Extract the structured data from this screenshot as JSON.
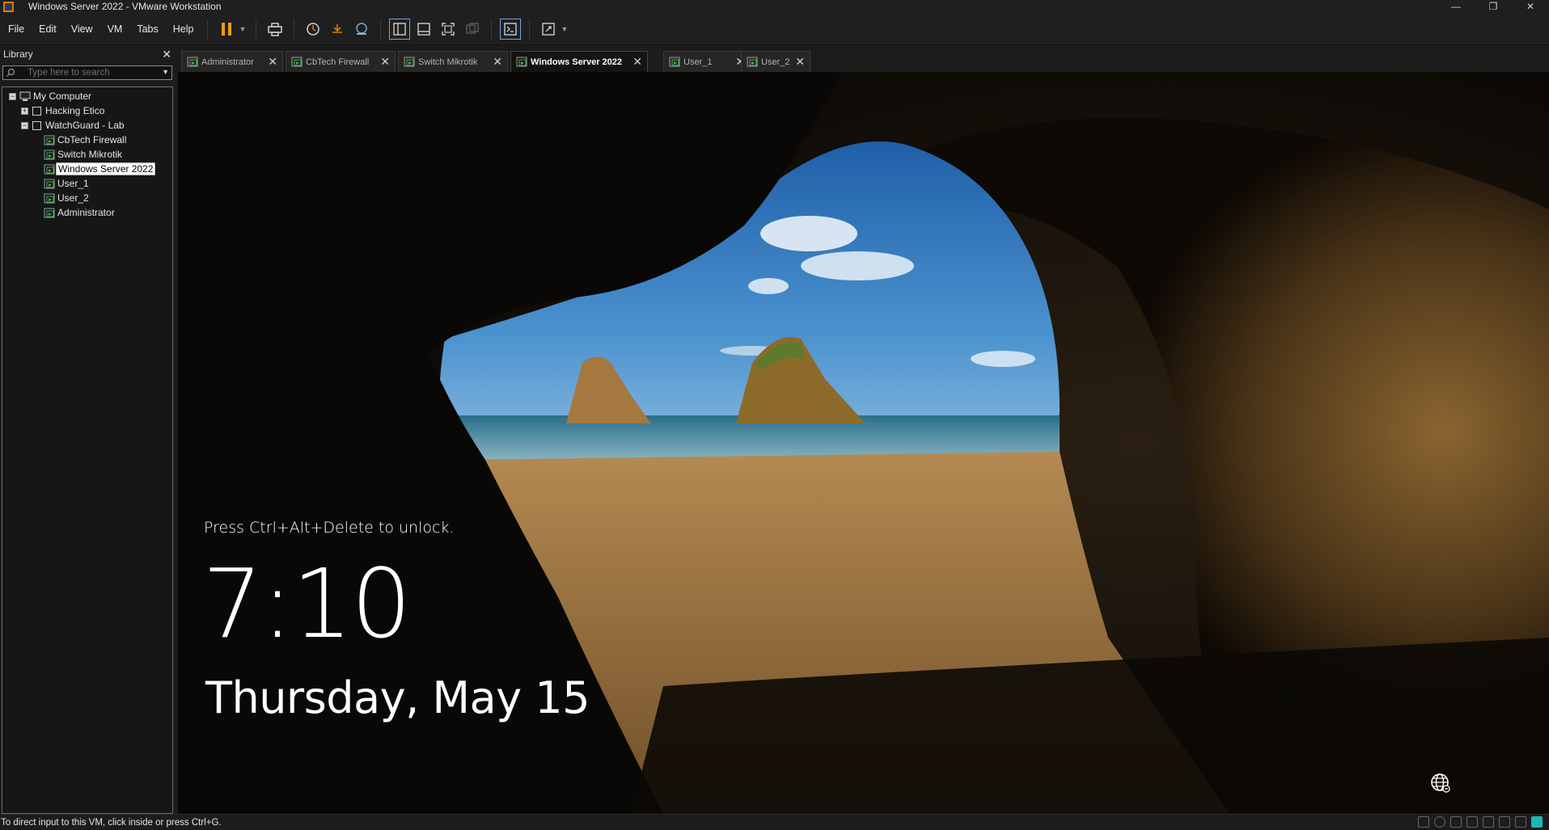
{
  "window": {
    "title": "Windows Server 2022 - VMware Workstation",
    "minimize_glyph": "—",
    "restore_glyph": "❐",
    "close_glyph": "✕"
  },
  "menu": {
    "items": [
      "File",
      "Edit",
      "View",
      "VM",
      "Tabs",
      "Help"
    ]
  },
  "toolbar": {
    "icons": [
      "pause-icon",
      "send-ctrl-alt-del-icon",
      "snapshot-icon",
      "revert-snapshot-icon",
      "snapshot-manager-icon",
      "library-view-icon",
      "thumbnail-view-icon",
      "fullscreen-icon",
      "unity-icon",
      "console-icon",
      "stretch-icon"
    ],
    "pause_color": "#f39c12"
  },
  "library": {
    "title": "Library",
    "close_glyph": "✕",
    "search_placeholder": "Type here to search",
    "tree": [
      {
        "label": "My Computer",
        "level": 0,
        "toggle": "−",
        "icon": "computer-icon"
      },
      {
        "label": "Hacking Etico",
        "level": 1,
        "toggle": "+",
        "icon": "folder-icon"
      },
      {
        "label": "WatchGuard - Lab",
        "level": 1,
        "toggle": "−",
        "icon": "folder-icon"
      },
      {
        "label": "CbTech Firewall",
        "level": 2,
        "icon": "vm-running-icon"
      },
      {
        "label": "Switch Mikrotik",
        "level": 2,
        "icon": "vm-running-icon"
      },
      {
        "label": "Windows Server 2022",
        "level": 2,
        "icon": "vm-running-icon",
        "selected": true
      },
      {
        "label": "User_1",
        "level": 2,
        "icon": "vm-running-icon"
      },
      {
        "label": "User_2",
        "level": 2,
        "icon": "vm-running-icon"
      },
      {
        "label": "Administrator",
        "level": 2,
        "icon": "vm-running-icon"
      }
    ]
  },
  "tabs": [
    {
      "label": "Administrator",
      "active": false
    },
    {
      "label": "CbTech Firewall",
      "active": false
    },
    {
      "label": "Switch Mikrotik",
      "active": false
    },
    {
      "label": "Windows Server 2022",
      "active": true
    },
    {
      "label": "User_1",
      "active": false
    },
    {
      "label": "User_2",
      "active": false
    }
  ],
  "vm": {
    "lock_hint": "Press Ctrl+Alt+Delete to unlock.",
    "time": "7:10",
    "date": "Thursday, May 15"
  },
  "status": {
    "text": "To direct input to this VM, click inside or press Ctrl+G."
  },
  "colors": {
    "vm_running_green": "#3cb44b",
    "accent_orange": "#e07b00"
  }
}
